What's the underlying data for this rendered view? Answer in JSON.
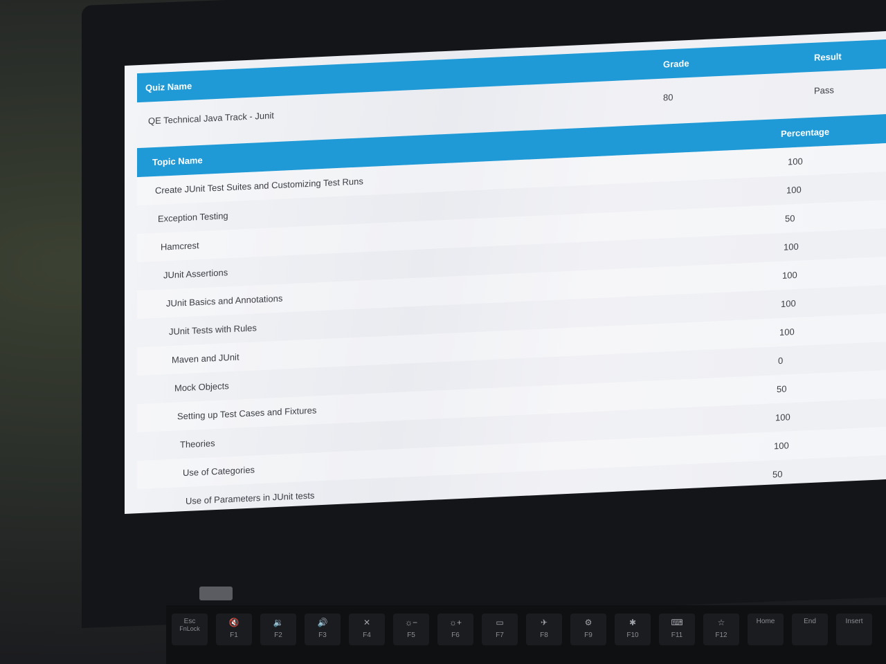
{
  "quiz": {
    "headers": {
      "name": "Quiz Name",
      "grade": "Grade",
      "result": "Result"
    },
    "row": {
      "name": "QE Technical Java Track - Junit",
      "grade": "80",
      "result": "Pass"
    }
  },
  "topics": {
    "headers": {
      "name": "Topic Name",
      "percentage": "Percentage"
    },
    "rows": [
      {
        "name": "Create JUnit Test Suites and Customizing Test Runs",
        "percentage": "100"
      },
      {
        "name": "Exception Testing",
        "percentage": "100"
      },
      {
        "name": "Hamcrest",
        "percentage": "50"
      },
      {
        "name": "JUnit Assertions",
        "percentage": "100"
      },
      {
        "name": "JUnit Basics and Annotations",
        "percentage": "100"
      },
      {
        "name": "JUnit Tests with Rules",
        "percentage": "100"
      },
      {
        "name": "Maven and JUnit",
        "percentage": "100"
      },
      {
        "name": "Mock Objects",
        "percentage": "0"
      },
      {
        "name": "Setting up Test Cases and Fixtures",
        "percentage": "50"
      },
      {
        "name": "Theories",
        "percentage": "100"
      },
      {
        "name": "Use of Categories",
        "percentage": "100"
      },
      {
        "name": "Use of Parameters in JUnit tests",
        "percentage": "50"
      }
    ]
  },
  "keyboard": {
    "keys": [
      {
        "icon": "",
        "label": "Esc",
        "sub": "FnLock",
        "icon_name": "esc-key"
      },
      {
        "icon": "🔇",
        "label": "F1",
        "icon_name": "mute-icon"
      },
      {
        "icon": "🔉",
        "label": "F2",
        "icon_name": "volume-down-icon"
      },
      {
        "icon": "🔊",
        "label": "F3",
        "icon_name": "volume-up-icon"
      },
      {
        "icon": "✕",
        "label": "F4",
        "icon_name": "mic-mute-icon"
      },
      {
        "icon": "☼−",
        "label": "F5",
        "icon_name": "brightness-down-icon"
      },
      {
        "icon": "☼+",
        "label": "F6",
        "icon_name": "brightness-up-icon"
      },
      {
        "icon": "▭",
        "label": "F7",
        "icon_name": "display-icon"
      },
      {
        "icon": "✈",
        "label": "F8",
        "icon_name": "airplane-icon"
      },
      {
        "icon": "⚙",
        "label": "F9",
        "icon_name": "settings-icon"
      },
      {
        "icon": "✱",
        "label": "F10",
        "icon_name": "bluetooth-icon"
      },
      {
        "icon": "⌨",
        "label": "F11",
        "icon_name": "keyboard-icon"
      },
      {
        "icon": "☆",
        "label": "F12",
        "icon_name": "star-icon"
      },
      {
        "icon": "",
        "label": "Home",
        "icon_name": "home-key"
      },
      {
        "icon": "",
        "label": "End",
        "icon_name": "end-key"
      },
      {
        "icon": "",
        "label": "Insert",
        "icon_name": "insert-key"
      }
    ]
  }
}
